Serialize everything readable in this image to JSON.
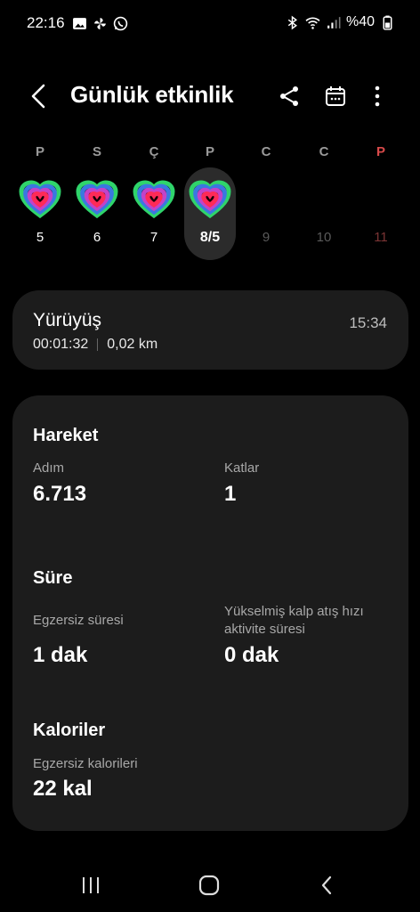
{
  "status": {
    "time": "22:16",
    "battery": "%40"
  },
  "header": {
    "title": "Günlük etkinlik",
    "icons": [
      "back-icon",
      "share-icon",
      "calendar-icon",
      "more-icon"
    ]
  },
  "week": {
    "days": [
      {
        "letter": "P",
        "num": "5",
        "has_heart": true
      },
      {
        "letter": "S",
        "num": "6",
        "has_heart": true
      },
      {
        "letter": "Ç",
        "num": "7",
        "has_heart": true
      },
      {
        "letter": "P",
        "num": "8/5",
        "has_heart": true,
        "selected": true
      },
      {
        "letter": "C",
        "num": "9",
        "has_heart": false
      },
      {
        "letter": "C",
        "num": "10",
        "has_heart": false
      },
      {
        "letter": "P",
        "num": "11",
        "has_heart": false
      }
    ],
    "heart_colors": [
      "#2fd46b",
      "#3a78e0",
      "#c243c9",
      "#ff2a57"
    ]
  },
  "workout": {
    "title": "Yürüyüş",
    "duration": "00:01:32",
    "distance": "0,02 km",
    "time": "15:34"
  },
  "activity": {
    "movement": {
      "title": "Hareket",
      "steps_label": "Adım",
      "steps_value": "6.713",
      "floors_label": "Katlar",
      "floors_value": "1"
    },
    "duration": {
      "title": "Süre",
      "exercise_label": "Egzersiz süresi",
      "exercise_value": "1 dak",
      "hr_label": "Yükselmiş kalp atış hızı aktivite süresi",
      "hr_value": "0 dak"
    },
    "calories": {
      "title": "Kaloriler",
      "exercise_label": "Egzersiz kalorileri",
      "exercise_value": "22 kal"
    }
  }
}
